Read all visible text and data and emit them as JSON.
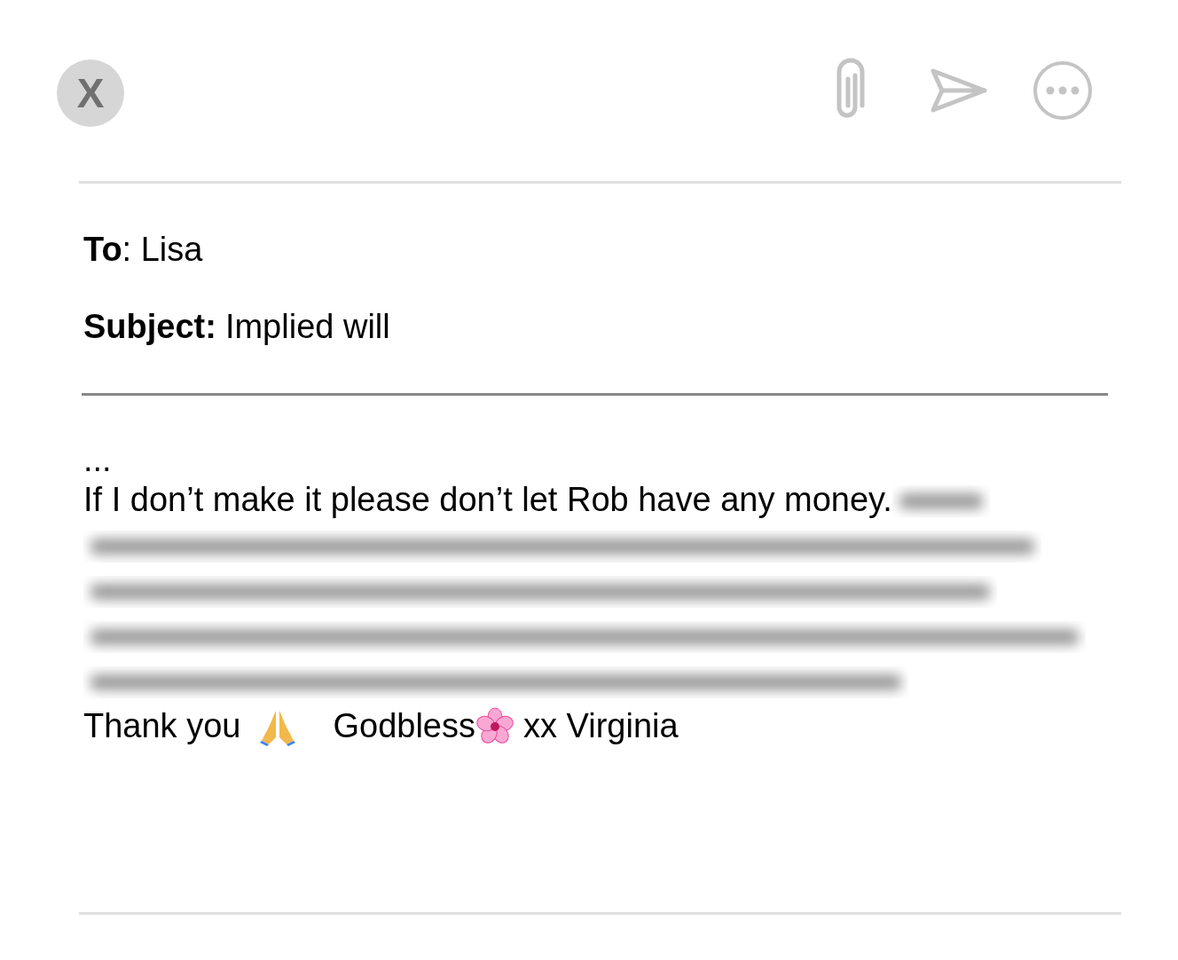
{
  "toolbar": {
    "close_label": "X"
  },
  "header": {
    "to_label": "To",
    "to_value": ": Lisa",
    "subject_label": "Subject:",
    "subject_value": "Implied will"
  },
  "body": {
    "ellipsis": "...",
    "first_line": "If I don’t make it please don’t let Rob have any money.",
    "signoff": [
      {
        "kind": "text",
        "text": "Thank you"
      },
      {
        "kind": "pray"
      },
      {
        "kind": "text",
        "text": "Godbless"
      },
      {
        "kind": "flower"
      },
      {
        "kind": "text",
        "text": "xx Virginia"
      }
    ]
  }
}
